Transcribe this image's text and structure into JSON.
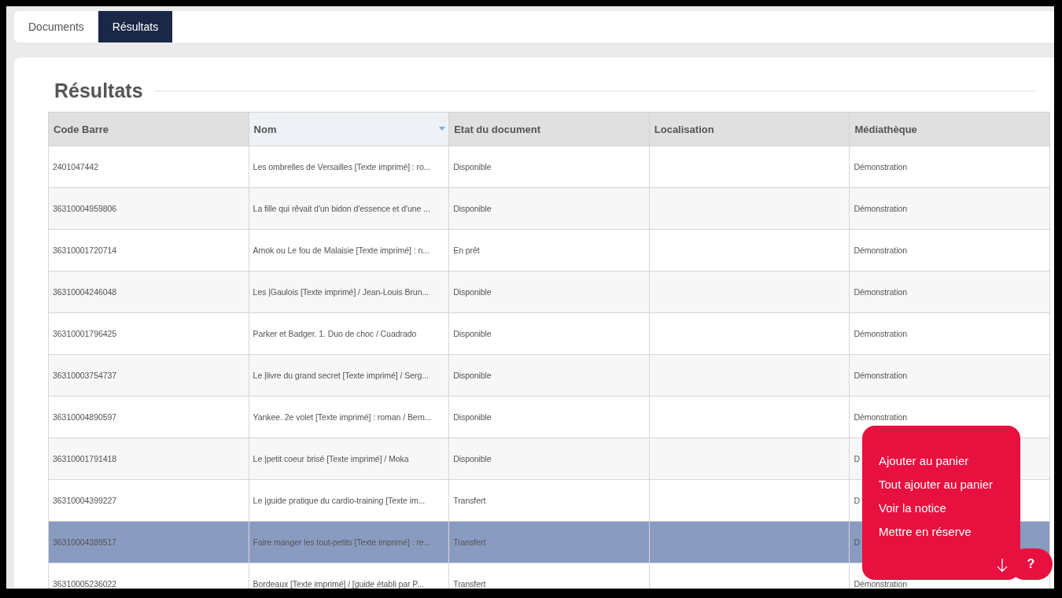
{
  "tabs": [
    {
      "label": "Documents",
      "selected": false
    },
    {
      "label": "Résultats",
      "selected": true
    }
  ],
  "section_title": "Résultats",
  "table": {
    "columns": [
      {
        "label": "Code Barre",
        "sorted": false
      },
      {
        "label": "Nom",
        "sorted": true
      },
      {
        "label": "Etat du document",
        "sorted": false
      },
      {
        "label": "Localisation",
        "sorted": false
      },
      {
        "label": "Médiathèque",
        "sorted": false
      }
    ],
    "rows": [
      {
        "cells": [
          "2401047442",
          "Les ombrelles de Versailles [Texte imprimé] : ro...",
          "Disponible",
          "",
          "Démonstration"
        ],
        "selected": false
      },
      {
        "cells": [
          "36310004959806",
          "La fille qui rêvait d'un bidon d'essence et d'une ...",
          "Disponible",
          "",
          "Démonstration"
        ],
        "selected": false
      },
      {
        "cells": [
          "36310001720714",
          "Amok ou Le fou de Malaisie [Texte imprimé] : n...",
          "En prêt",
          "",
          "Démonstration"
        ],
        "selected": false
      },
      {
        "cells": [
          "36310004246048",
          "Les |Gaulois [Texte imprimé] / Jean-Louis Brun...",
          "Disponible",
          "",
          "Démonstration"
        ],
        "selected": false
      },
      {
        "cells": [
          "36310001796425",
          "Parker et Badger. 1. Duo de choc / Cuadrado",
          "Disponible",
          "",
          "Démonstration"
        ],
        "selected": false
      },
      {
        "cells": [
          "36310003754737",
          "Le |livre du grand secret [Texte imprimé] / Serg...",
          "Disponible",
          "",
          "Démonstration"
        ],
        "selected": false
      },
      {
        "cells": [
          "36310004890597",
          "Yankee. 2e volet [Texte imprimé] : roman / Bern...",
          "Disponible",
          "",
          "Démonstration"
        ],
        "selected": false
      },
      {
        "cells": [
          "36310001791418",
          "Le |petit coeur brisé [Texte imprimé] / Moka",
          "Disponible",
          "",
          "D"
        ],
        "selected": false
      },
      {
        "cells": [
          "36310004399227",
          "Le |guide pratique du cardio-training [Texte im...",
          "Transfert",
          "",
          "D"
        ],
        "selected": false
      },
      {
        "cells": [
          "36310004389517",
          "Faire manger les tout-petits [Texte imprimé] : re...",
          "Transfert",
          "",
          "D"
        ],
        "selected": true
      },
      {
        "cells": [
          "36310005236022",
          "Bordeaux [Texte imprimé] / [guide établi par P...",
          "Transfert",
          "",
          "Démonstration"
        ],
        "selected": false
      }
    ]
  },
  "action_menu": {
    "items": [
      "Ajouter au panier",
      "Tout ajouter au panier",
      "Voir la notice",
      "Mettre en réserve"
    ]
  },
  "help_button": {
    "label": "?"
  }
}
